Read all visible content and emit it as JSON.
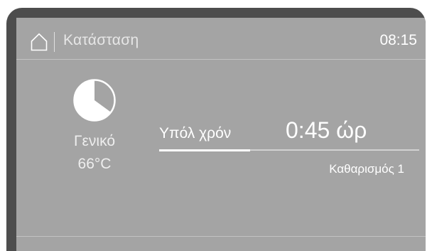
{
  "header": {
    "title": "Κατάσταση",
    "clock": "08:15",
    "home_icon": "home-icon"
  },
  "program": {
    "icon": "pie-progress-icon",
    "name": "Γενικό",
    "temperature": "66°C"
  },
  "remaining": {
    "label": "Υπόλ χρόν",
    "value": "0:45 ώρ"
  },
  "progress": {
    "fraction": 0.35
  },
  "phase": {
    "label": "Καθαρισμός 1"
  },
  "colors": {
    "bezel": "#4d4d4d",
    "screen": "#a4a4a4",
    "text": "#ffffff",
    "track": "#d2d2d2"
  }
}
